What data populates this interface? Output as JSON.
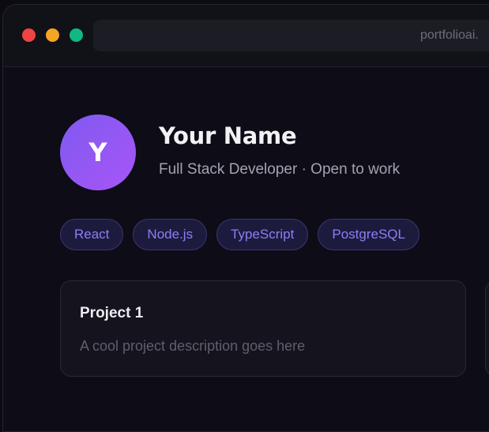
{
  "browser": {
    "url": "portfolioai."
  },
  "profile": {
    "avatar_initial": "Y",
    "name": "Your Name",
    "tagline": "Full Stack Developer · Open to work"
  },
  "skills": [
    "React",
    "Node.js",
    "TypeScript",
    "PostgreSQL"
  ],
  "projects": [
    {
      "title": "Project 1",
      "description": "A cool project description goes here"
    }
  ],
  "colors": {
    "background": "#0d0c17",
    "accent": "#8b7ff6",
    "avatar_gradient_start": "#7f5af0",
    "avatar_gradient_end": "#a855f7",
    "traffic_red": "#ef4444",
    "traffic_yellow": "#f5a524",
    "traffic_green": "#10b981"
  }
}
